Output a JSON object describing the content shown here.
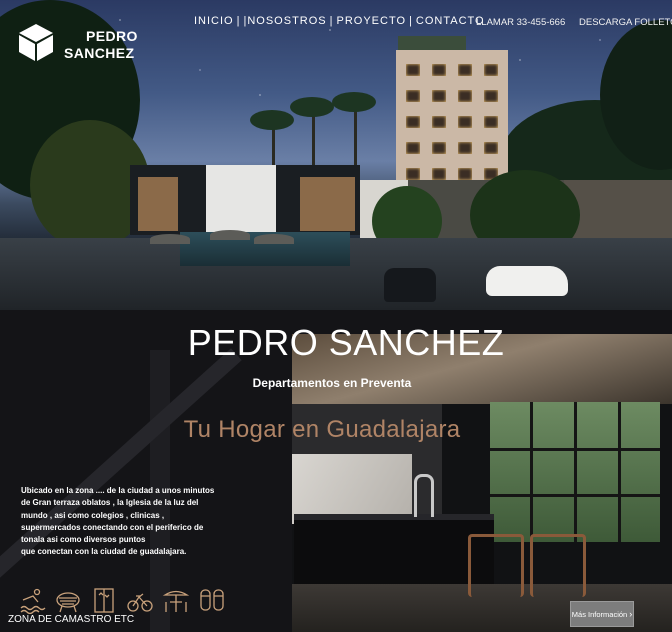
{
  "brand": {
    "line1": "PEDRO",
    "line2": "SANCHEZ",
    "logo_icon": "cube-icon"
  },
  "nav": {
    "items": [
      {
        "label": "INICIO"
      },
      {
        "label": "|NOSOSTROS"
      },
      {
        "label": "PROYECTO"
      },
      {
        "label": "CONTACTO"
      }
    ],
    "separator": "|",
    "phone": "LLAMAR 33-455-666",
    "brochure": "DESCARGA FOLLETO"
  },
  "hero": {
    "image": "night-rendering-of-residential-tower-with-palms-and-cars"
  },
  "main": {
    "title": "PEDRO SANCHEZ",
    "subtitle": "Departamentos en Preventa",
    "tagline": "Tu Hogar en Guadalajara",
    "description_lines": [
      "Ubicado en la zona .... de la ciudad  a unos minutos",
      "de Gran terraza oblatos , la Iglesia de la luz del",
      "mundo , asi como colegios , clinicas ,",
      "supermercados  conectando con el periferico de",
      "tonala asi como diversos puntos",
      "que conectan con la ciudad  de guadalajara."
    ],
    "amenities": [
      "pool-lounger-icon",
      "grill-icon",
      "elevator-icon",
      "gym-bike-icon",
      "terrace-table-icon",
      "parking-icon"
    ],
    "amenities_label": "ZONA DE CAMASTRO ETC",
    "more_button": "Más Información",
    "more_chevron": "›",
    "accent_color": "#b08466"
  }
}
